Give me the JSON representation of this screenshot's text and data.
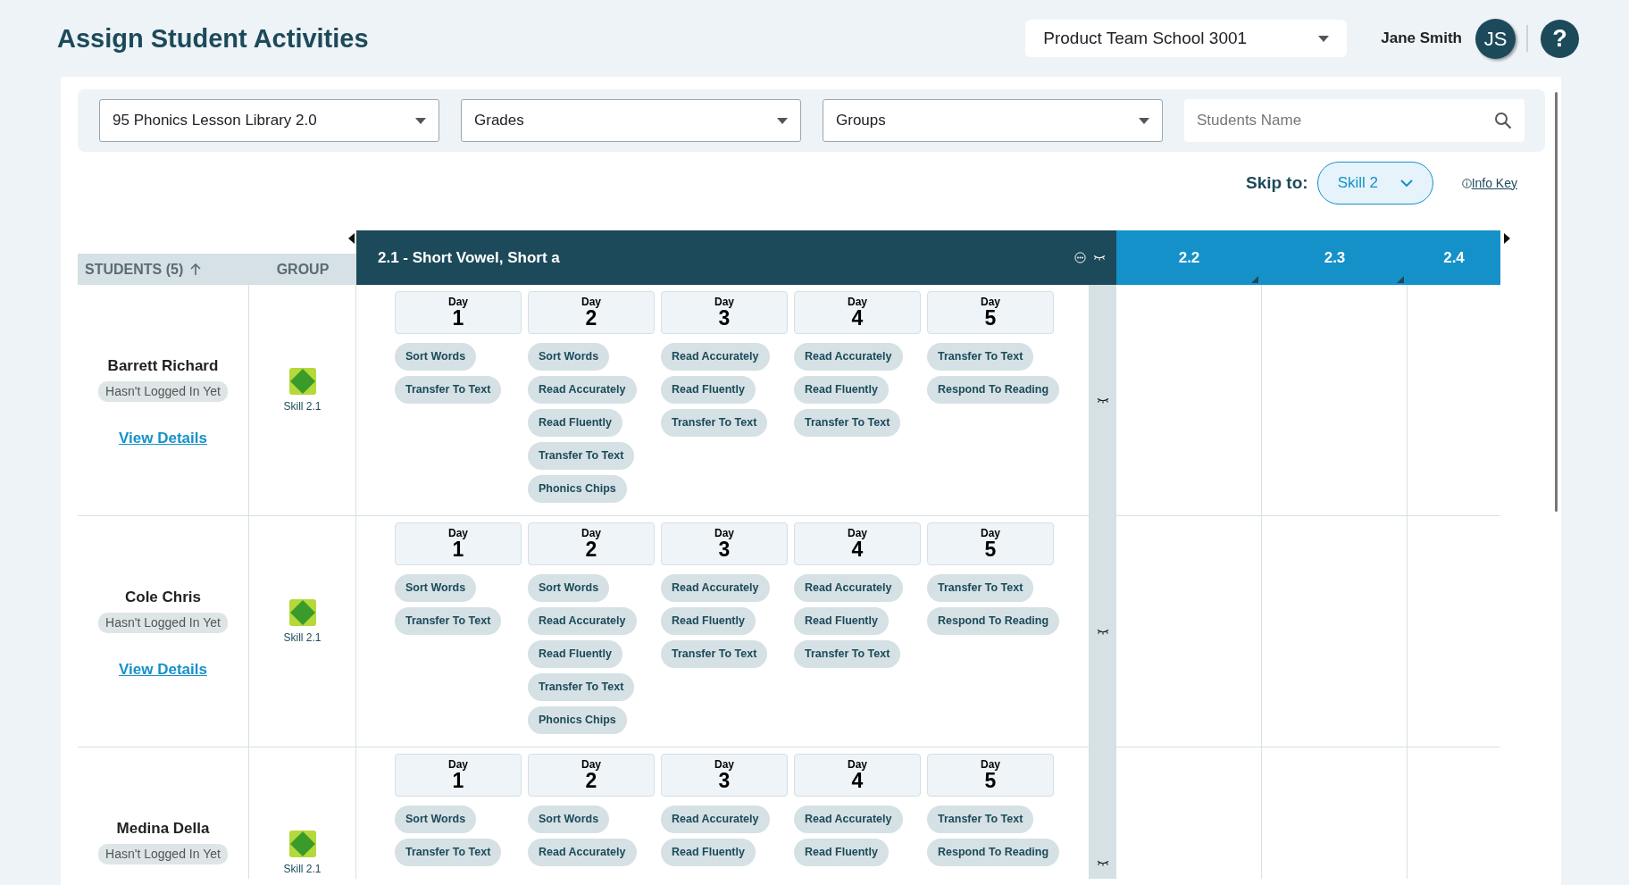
{
  "header": {
    "title": "Assign Student Activities",
    "school": {
      "value": "Product Team School 3001"
    },
    "user": {
      "name": "Jane Smith",
      "initials": "JS"
    },
    "help": "?"
  },
  "filters": [
    {
      "kind": "select",
      "value": "95 Phonics Lesson Library 2.0"
    },
    {
      "kind": "select",
      "value": "Grades"
    },
    {
      "kind": "select",
      "value": "Groups"
    },
    {
      "kind": "search",
      "placeholder": "Students Name"
    }
  ],
  "skip_to": {
    "label": "Skip to:",
    "value": "Skill 2"
  },
  "info_key": "Info Key",
  "table": {
    "columns": [
      {
        "label": "STUDENTS (5)",
        "sorted": true
      },
      {
        "label": "GROUP",
        "sorted": false
      }
    ],
    "skills": [
      {
        "label": "2.1 - Short Vowel, Short a",
        "expanded": true,
        "flagged": false
      },
      {
        "label": "2.2",
        "expanded": false,
        "flagged": true
      },
      {
        "label": "2.3",
        "expanded": false,
        "flagged": true
      },
      {
        "label": "2.4",
        "expanded": false,
        "flagged": false
      }
    ],
    "students": [
      {
        "name": "Barrett Richard",
        "status": "Hasn't Logged In Yet",
        "link": "View Details",
        "group": "Skill 2.1",
        "days": [
          {
            "label": "Day",
            "number": "1",
            "activities": [
              "Sort Words",
              "Transfer To Text"
            ]
          },
          {
            "label": "Day",
            "number": "2",
            "activities": [
              "Sort Words",
              "Read Accurately",
              "Read Fluently",
              "Transfer To Text",
              "Phonics Chips"
            ]
          },
          {
            "label": "Day",
            "number": "3",
            "activities": [
              "Read Accurately",
              "Read Fluently",
              "Transfer To Text"
            ]
          },
          {
            "label": "Day",
            "number": "4",
            "activities": [
              "Read Accurately",
              "Read Fluently",
              "Transfer To Text"
            ]
          },
          {
            "label": "Day",
            "number": "5",
            "activities": [
              "Transfer To Text",
              "Respond To Reading"
            ]
          }
        ]
      },
      {
        "name": "Cole Chris",
        "status": "Hasn't Logged In Yet",
        "link": "View Details",
        "group": "Skill 2.1",
        "days": [
          {
            "label": "Day",
            "number": "1",
            "activities": [
              "Sort Words",
              "Transfer To Text"
            ]
          },
          {
            "label": "Day",
            "number": "2",
            "activities": [
              "Sort Words",
              "Read Accurately",
              "Read Fluently",
              "Transfer To Text",
              "Phonics Chips"
            ]
          },
          {
            "label": "Day",
            "number": "3",
            "activities": [
              "Read Accurately",
              "Read Fluently",
              "Transfer To Text"
            ]
          },
          {
            "label": "Day",
            "number": "4",
            "activities": [
              "Read Accurately",
              "Read Fluently",
              "Transfer To Text"
            ]
          },
          {
            "label": "Day",
            "number": "5",
            "activities": [
              "Transfer To Text",
              "Respond To Reading"
            ]
          }
        ]
      },
      {
        "name": "Medina Della",
        "status": "Hasn't Logged In Yet",
        "group": "Skill 2.1",
        "days": [
          {
            "label": "Day",
            "number": "1",
            "activities": [
              "Sort Words",
              "Transfer To Text"
            ]
          },
          {
            "label": "Day",
            "number": "2",
            "activities": [
              "Sort Words",
              "Read Accurately"
            ]
          },
          {
            "label": "Day",
            "number": "3",
            "activities": [
              "Read Accurately",
              "Read Fluently"
            ]
          },
          {
            "label": "Day",
            "number": "4",
            "activities": [
              "Read Accurately",
              "Read Fluently"
            ]
          },
          {
            "label": "Day",
            "number": "5",
            "activities": [
              "Transfer To Text",
              "Respond To Reading"
            ]
          }
        ]
      }
    ]
  }
}
